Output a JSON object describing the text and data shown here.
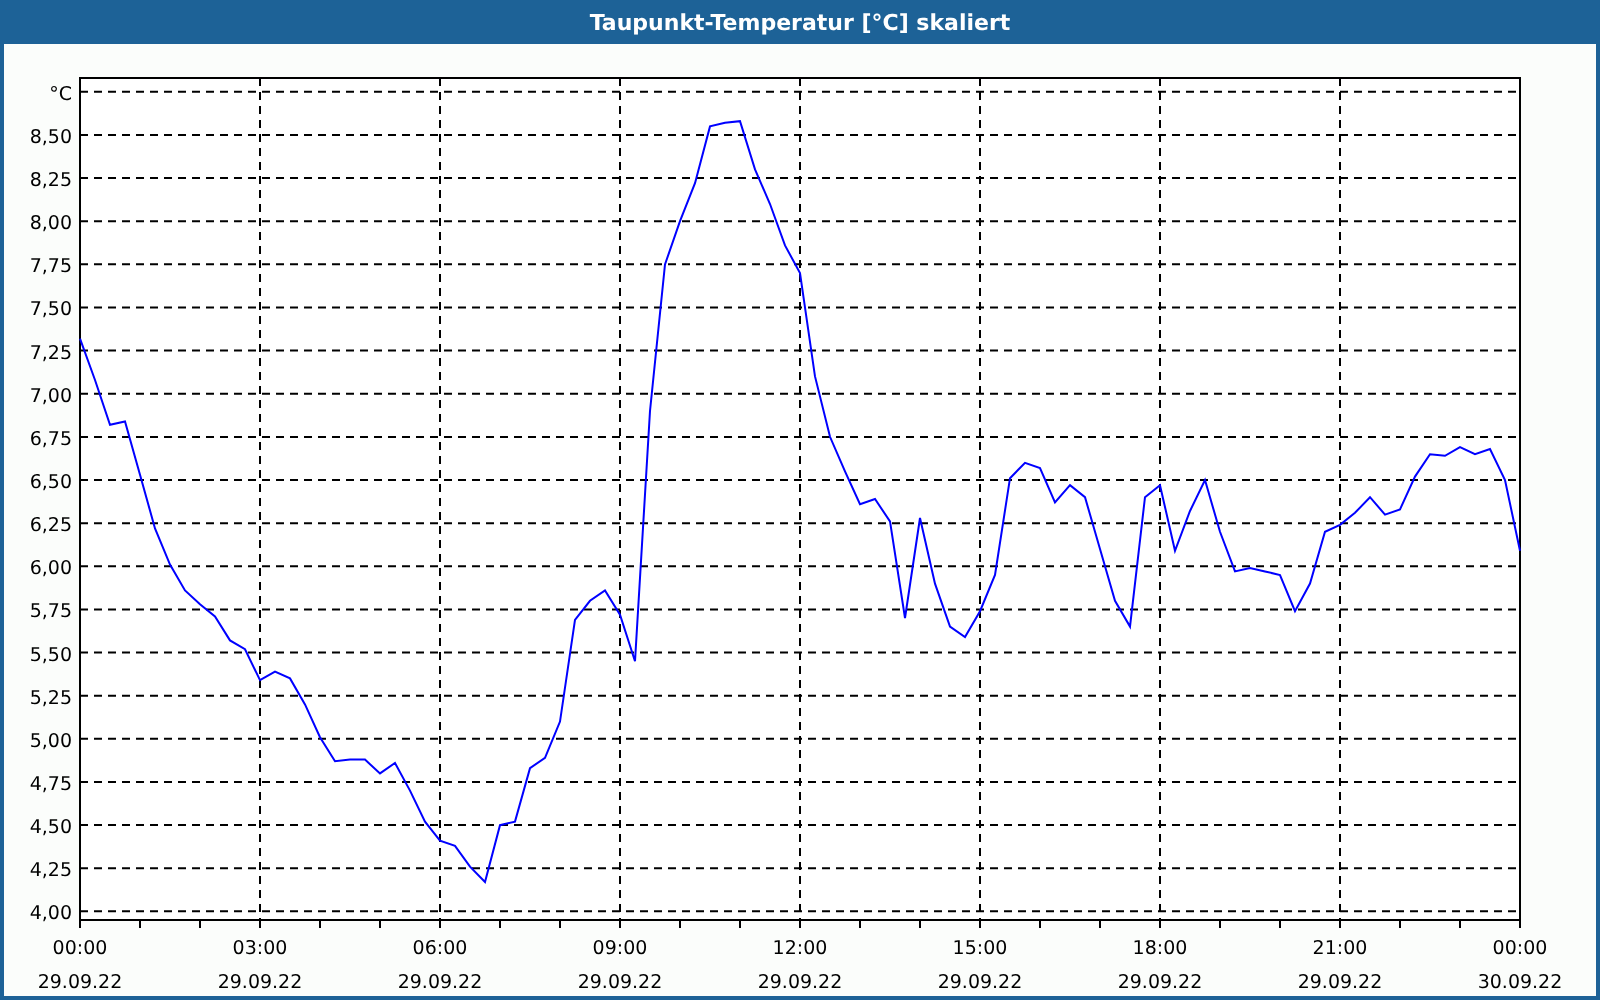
{
  "window": {
    "title": "Taupunkt-Temperatur [°C] skaliert"
  },
  "chart": {
    "chart_data": {
      "type": "line",
      "grid": true,
      "ylim": [
        3.95,
        8.83
      ],
      "yticks": [
        {
          "value": 4,
          "label": "4,00"
        },
        {
          "value": 4.25,
          "label": "4,25"
        },
        {
          "value": 4.5,
          "label": "4,50"
        },
        {
          "value": 4.75,
          "label": "4,75"
        },
        {
          "value": 5,
          "label": "5,00"
        },
        {
          "value": 5.25,
          "label": "5,25"
        },
        {
          "value": 5.5,
          "label": "5,50"
        },
        {
          "value": 5.75,
          "label": "5,75"
        },
        {
          "value": 6,
          "label": "6,00"
        },
        {
          "value": 6.25,
          "label": "6,25"
        },
        {
          "value": 6.5,
          "label": "6,50"
        },
        {
          "value": 6.75,
          "label": "6,75"
        },
        {
          "value": 7,
          "label": "7,00"
        },
        {
          "value": 7.25,
          "label": "7,25"
        },
        {
          "value": 7.5,
          "label": "7,50"
        },
        {
          "value": 7.75,
          "label": "7,75"
        },
        {
          "value": 8,
          "label": "8,00"
        },
        {
          "value": 8.25,
          "label": "8,25"
        },
        {
          "value": 8.5,
          "label": "8,50"
        },
        {
          "value": 8.75,
          "label": "°C"
        }
      ],
      "categories": [
        "00:00 29.09.22",
        null,
        null,
        null,
        null,
        null,
        null,
        null,
        null,
        null,
        null,
        null,
        "03:00 29.09.22",
        null,
        null,
        null,
        null,
        null,
        null,
        null,
        null,
        null,
        null,
        null,
        "06:00 29.09.22",
        null,
        null,
        null,
        null,
        null,
        null,
        null,
        null,
        null,
        null,
        null,
        "09:00 29.09.22",
        null,
        null,
        null,
        null,
        null,
        null,
        null,
        null,
        null,
        null,
        null,
        "12:00 29.09.22",
        null,
        null,
        null,
        null,
        null,
        null,
        null,
        null,
        null,
        null,
        null,
        "15:00 29.09.22",
        null,
        null,
        null,
        null,
        null,
        null,
        null,
        null,
        null,
        null,
        null,
        "18:00 29.09.22",
        null,
        null,
        null,
        null,
        null,
        null,
        null,
        null,
        null,
        null,
        null,
        "21:00 29.09.22",
        null,
        null,
        null,
        null,
        null,
        null,
        null,
        null,
        null,
        null,
        null,
        "00:00 30.09.22"
      ],
      "series": [
        {
          "color": "#0000ff",
          "values": [
            7.32,
            7.08,
            6.82,
            6.84,
            6.53,
            6.22,
            6.01,
            5.86,
            5.78,
            5.71,
            5.57,
            5.52,
            5.34,
            5.39,
            5.35,
            5.2,
            5.01,
            4.87,
            4.88,
            4.88,
            4.8,
            4.86,
            4.7,
            4.52,
            4.41,
            4.38,
            4.26,
            4.17,
            4.5,
            4.52,
            4.83,
            4.89,
            5.1,
            5.69,
            5.8,
            5.86,
            5.72,
            5.45,
            6.9,
            7.75,
            8,
            8.22,
            8.55,
            8.57,
            8.58,
            8.3,
            8.1,
            7.86,
            7.7,
            7.1,
            6.75,
            6.55,
            6.36,
            6.39,
            6.26,
            5.7,
            6.28,
            5.9,
            5.65,
            5.59,
            5.74,
            5.95,
            6.51,
            6.6,
            6.57,
            6.37,
            6.47,
            6.4,
            6.1,
            5.8,
            5.65,
            6.4,
            6.47,
            6.09,
            6.32,
            6.5,
            6.2,
            5.97,
            5.99,
            5.97,
            5.95,
            5.74,
            5.9,
            6.2,
            6.24,
            6.31,
            6.4,
            6.3,
            6.33,
            6.52,
            6.65,
            6.64,
            6.69,
            6.65,
            6.68,
            6.5,
            6.09
          ]
        }
      ]
    }
  }
}
